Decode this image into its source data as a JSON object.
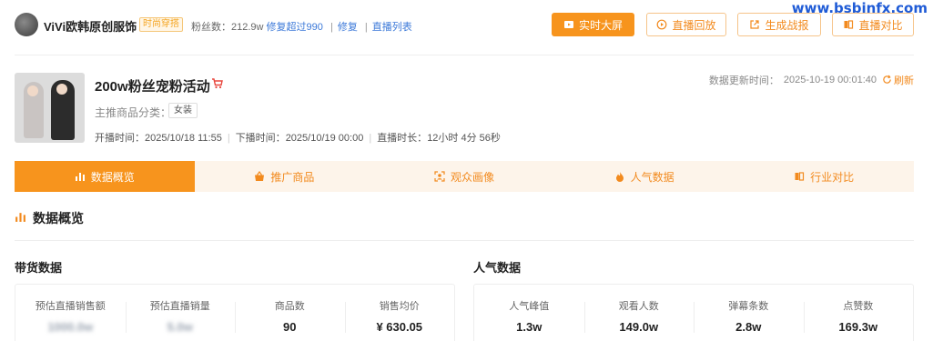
{
  "header": {
    "shop_name": "ViVi欧韩原创服饰",
    "shop_tag": "时尚穿搭",
    "fans_label": "粉丝数：",
    "fans_value": "212.9w",
    "fans_link_1": "修复超过990",
    "fans_link_2": "修复",
    "fans_link_3": "直播列表",
    "separator": "|",
    "buttons": {
      "screen": "实时大屏",
      "replay": "直播回放",
      "report": "生成战报",
      "compare": "直播对比"
    }
  },
  "live": {
    "title": "200w粉丝宠粉活动",
    "category_label": "主推商品分类：",
    "category_tag": "女装",
    "start_label": "开播时间：",
    "start_value": "2025/10/18 11:55",
    "end_label": "下播时间：",
    "end_value": "2025/10/19 00:00",
    "duration_label": "直播时长：",
    "duration_value": "12小时 4分 56秒",
    "update_label": "数据更新时间：",
    "update_value": "2025-10-19 00:01:40",
    "refresh_label": "刷新"
  },
  "tabs": [
    {
      "label": "数据概览",
      "icon": "bar-chart-icon",
      "active": true
    },
    {
      "label": "推广商品",
      "icon": "basket-icon",
      "active": false
    },
    {
      "label": "观众画像",
      "icon": "face-scan-icon",
      "active": false
    },
    {
      "label": "人气数据",
      "icon": "flame-icon",
      "active": false
    },
    {
      "label": "行业对比",
      "icon": "compare-icon",
      "active": false
    }
  ],
  "overview": {
    "title": "数据概览",
    "sales": {
      "title": "带货数据",
      "metrics": [
        {
          "label": "预估直播销售额",
          "value": "1000.0w"
        },
        {
          "label": "预估直播销量",
          "value": "5.0w"
        },
        {
          "label": "商品数",
          "value": "90"
        },
        {
          "label": "销售均价",
          "value": "¥ 630.05"
        }
      ]
    },
    "popularity": {
      "title": "人气数据",
      "metrics": [
        {
          "label": "人气峰值",
          "value": "1.3w"
        },
        {
          "label": "观看人数",
          "value": "149.0w"
        },
        {
          "label": "弹幕条数",
          "value": "2.8w"
        },
        {
          "label": "点赞数",
          "value": "169.3w"
        }
      ]
    }
  },
  "watermark": "www.bsbinfx.com",
  "colors": {
    "accent": "#f7941d",
    "accent_text": "#f28a1e",
    "link": "#3b78d8",
    "tab_bg": "#fdf4ea"
  }
}
